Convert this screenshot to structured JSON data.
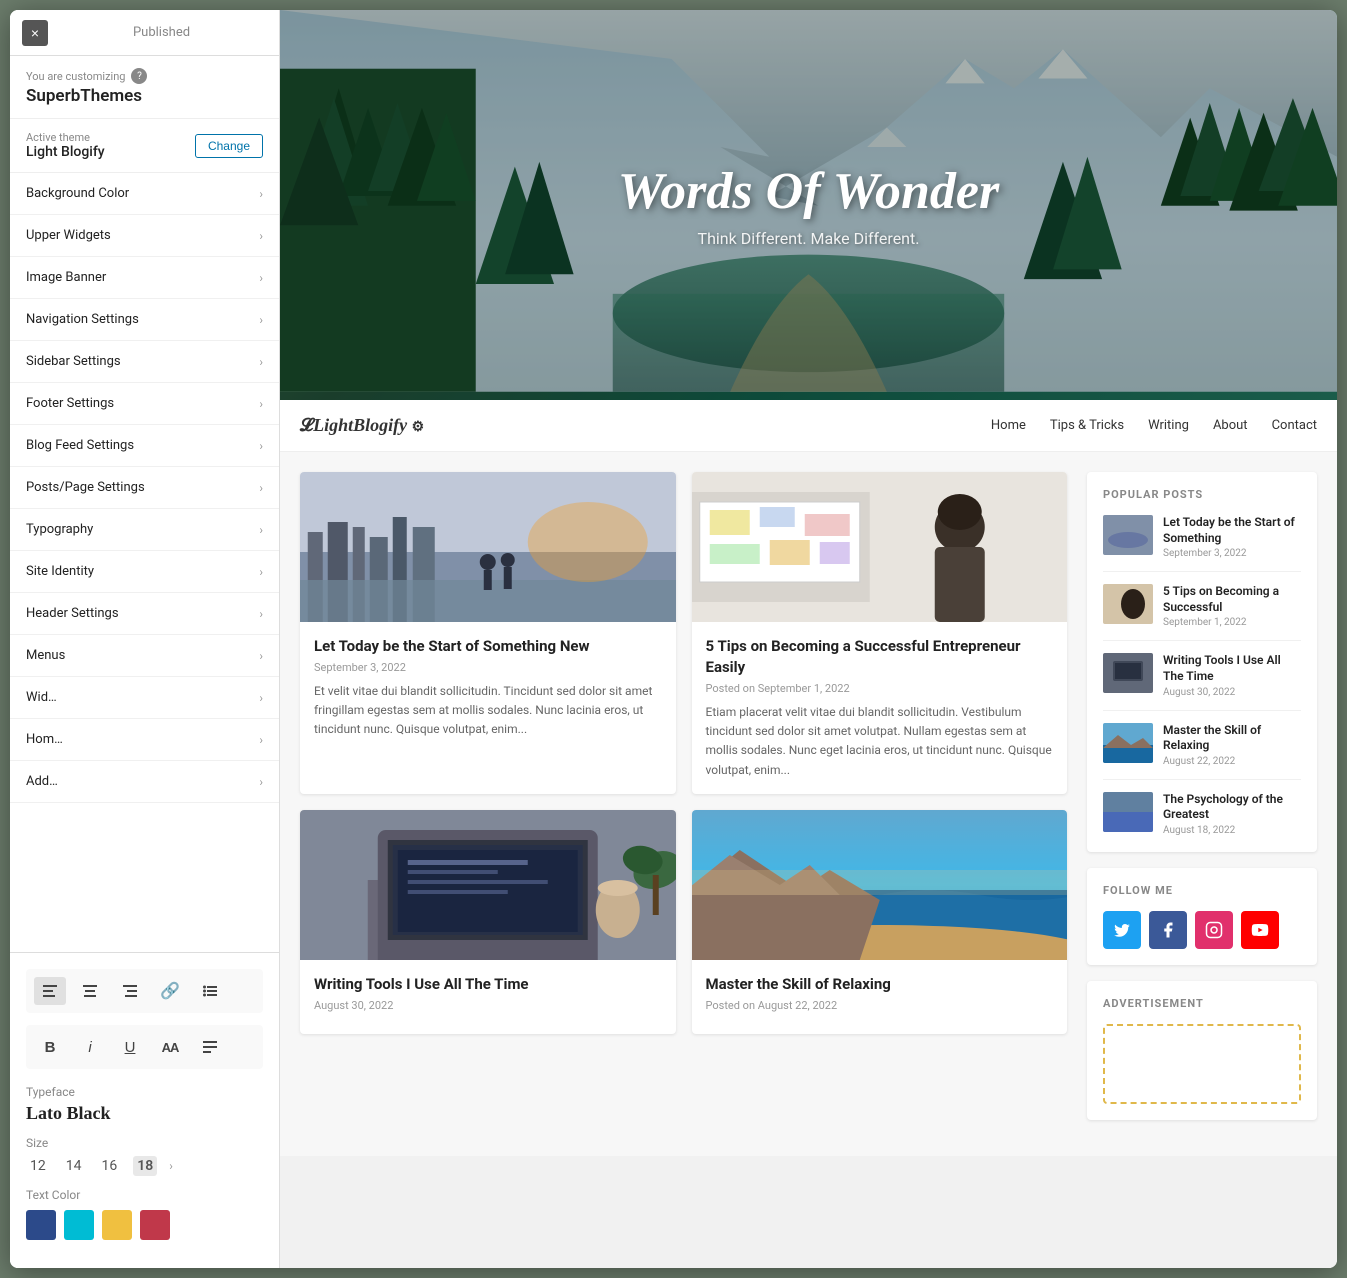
{
  "customizer": {
    "close_label": "×",
    "published_label": "Published",
    "you_are_customizing": "You are customizing",
    "help_icon": "?",
    "site_name": "SuperbThemes",
    "active_theme_label": "Active theme",
    "theme_name": "Light Blogify",
    "change_button": "Change",
    "menu_items": [
      {
        "label": "Background Color",
        "id": "background-color"
      },
      {
        "label": "Upper Widgets",
        "id": "upper-widgets"
      },
      {
        "label": "Image Banner",
        "id": "image-banner"
      },
      {
        "label": "Navigation Settings",
        "id": "navigation-settings"
      },
      {
        "label": "Sidebar Settings",
        "id": "sidebar-settings"
      },
      {
        "label": "Footer Settings",
        "id": "footer-settings"
      },
      {
        "label": "Blog Feed Settings",
        "id": "blog-feed-settings"
      },
      {
        "label": "Posts/Page Settings",
        "id": "posts-page-settings"
      },
      {
        "label": "Typography",
        "id": "typography"
      },
      {
        "label": "Site Identity",
        "id": "site-identity"
      },
      {
        "label": "Header Settings",
        "id": "header-settings"
      },
      {
        "label": "Menus",
        "id": "menus"
      },
      {
        "label": "Wid…",
        "id": "widgets"
      },
      {
        "label": "Hom…",
        "id": "homepage"
      },
      {
        "label": "Add…",
        "id": "additional"
      }
    ],
    "typography_popup": {
      "typeface_label": "Typeface",
      "typeface_value": "Lato Black",
      "size_label": "Size",
      "sizes": [
        "12",
        "14",
        "16",
        "18"
      ],
      "selected_size": "18",
      "text_color_label": "Text Color",
      "colors": [
        {
          "hex": "#2c4a8a",
          "name": "dark-blue"
        },
        {
          "hex": "#00bcd4",
          "name": "cyan"
        },
        {
          "hex": "#f0c040",
          "name": "yellow"
        },
        {
          "hex": "#c0384a",
          "name": "red"
        }
      ]
    }
  },
  "blog": {
    "hero_title": "Words Of Wonder",
    "hero_subtitle": "Think Different. Make Different.",
    "logo_text": "LightBlogify",
    "nav_links": [
      {
        "label": "Home"
      },
      {
        "label": "Tips & Tricks"
      },
      {
        "label": "Writing"
      },
      {
        "label": "About"
      },
      {
        "label": "Contact"
      }
    ],
    "posts": [
      {
        "title": "Let Today be the Start of Something New",
        "date": "September 3, 2022",
        "date_label": "September 3, 2022",
        "excerpt": "Et velit vitae dui blandit sollicitudin. Tincidunt sed dolor sit amet fringillam egestas sem at mollis sodales. Nunc lacinia eros, ut tincidunt nunc. Quisque volutpat, enim...",
        "image_colors": [
          "#b0b8c8",
          "#d4c4a8",
          "#8090a8"
        ]
      },
      {
        "title": "5 Tips on Becoming a Successful Entrepreneur Easily",
        "date": "September 1, 2022",
        "date_label": "Posted on September 1, 2022",
        "excerpt": "Etiam placerat velit vitae dui blandit sollicitudin. Vestibulum tincidunt sed dolor sit amet volutpat. Nullam egestas sem at mollis sodales. Nunc eget lacinia eros, ut tincidunt nunc. Quisque volutpat, enim...",
        "image_colors": [
          "#e8e4de",
          "#c8c0b8",
          "#a89880"
        ]
      },
      {
        "title": "Writing Tools I Use All The Time",
        "date": "August 30, 2022",
        "date_label": "August 30, 2022",
        "excerpt": "",
        "image_colors": [
          "#808898",
          "#606878",
          "#404858"
        ]
      },
      {
        "title": "Master the Skill of Relaxing",
        "date": "August 22, 2022",
        "date_label": "Posted on August 22, 2022",
        "excerpt": "",
        "image_colors": [
          "#d4a060",
          "#a07040",
          "#704820"
        ]
      }
    ],
    "popular_posts": [
      {
        "title": "Let Today be the Start of Something",
        "date": "September 3, 2022",
        "thumb_colors": [
          "#8090a8",
          "#b0b8c8"
        ]
      },
      {
        "title": "5 Tips on Becoming a Successful",
        "date": "September 1, 2022",
        "thumb_colors": [
          "#d4c4a8",
          "#e8e0d0"
        ]
      },
      {
        "title": "Writing Tools I Use All The Time",
        "date": "August 30, 2022",
        "thumb_colors": [
          "#606878",
          "#808898"
        ]
      },
      {
        "title": "Master the Skill of Relaxing",
        "date": "August 22, 2022",
        "thumb_colors": [
          "#c8a070",
          "#a07840"
        ]
      },
      {
        "title": "The Psychology of the Greatest",
        "date": "August 18, 2022",
        "thumb_colors": [
          "#6080a0",
          "#4060c0"
        ]
      }
    ],
    "follow_me_heading": "FOLLOW ME",
    "advertisement_heading": "ADVERTISEMENT",
    "popular_posts_heading": "POPULAR POSTS"
  }
}
